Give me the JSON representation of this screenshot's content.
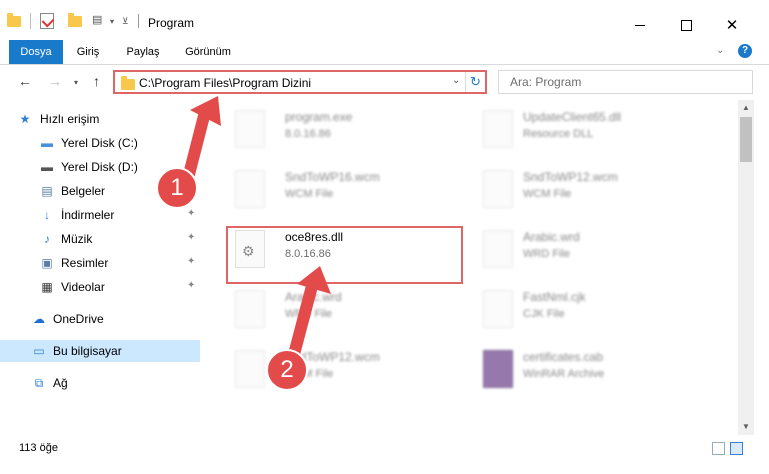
{
  "window": {
    "title": "Program",
    "minimize_icon": "minimize-icon",
    "maximize_icon": "maximize-icon",
    "close_icon": "close-icon"
  },
  "ribbon": {
    "tabs": [
      {
        "label": "Dosya",
        "active": true
      },
      {
        "label": "Giriş",
        "active": false
      },
      {
        "label": "Paylaş",
        "active": false
      },
      {
        "label": "Görünüm",
        "active": false
      }
    ],
    "help_icon": "?"
  },
  "address": {
    "path": "C:\\Program Files\\Program Dizini",
    "search_placeholder": "Ara: Program"
  },
  "sidebar": {
    "items": [
      {
        "label": "Hızlı erişim",
        "icon": "star-icon"
      },
      {
        "label": "Yerel Disk (C:)",
        "icon": "drive-icon"
      },
      {
        "label": "Yerel Disk (D:)",
        "icon": "drive-icon"
      },
      {
        "label": "Belgeler",
        "icon": "document-icon"
      },
      {
        "label": "İndirmeler",
        "icon": "download-icon"
      },
      {
        "label": "Müzik",
        "icon": "music-icon"
      },
      {
        "label": "Resimler",
        "icon": "pictures-icon"
      },
      {
        "label": "Videolar",
        "icon": "video-icon"
      },
      {
        "label": "OneDrive",
        "icon": "cloud-icon"
      },
      {
        "label": "Bu bilgisayar",
        "icon": "computer-icon"
      },
      {
        "label": "Ağ",
        "icon": "network-icon"
      }
    ]
  },
  "files": [
    {
      "name": "program.exe",
      "sub": "8.0.16.86"
    },
    {
      "name": "UpdateClient65.dll",
      "sub": "Resource DLL"
    },
    {
      "name": "SndToWP16.wcm",
      "sub": "WCM File"
    },
    {
      "name": "SndToWP12.wcm",
      "sub": "WCM File"
    },
    {
      "name": "oce8res.dll",
      "sub": "8.0.16.86"
    },
    {
      "name": "Arabic.wrd",
      "sub": "WRD File"
    },
    {
      "name": "Arabic.wrd",
      "sub": "WRD File"
    },
    {
      "name": "FastNml.cjk",
      "sub": "CJK File"
    },
    {
      "name": "SndToWP12.wcm",
      "sub": "WCM File"
    },
    {
      "name": "certificates.cab",
      "sub": "WinRAR Archive"
    }
  ],
  "annotations": {
    "step1": "1",
    "step2": "2"
  },
  "status": {
    "count": "113 öğe"
  },
  "colors": {
    "accent": "#1979ca",
    "highlight": "#e06666",
    "badge": "#e34b4b",
    "selected": "#cce8ff"
  }
}
